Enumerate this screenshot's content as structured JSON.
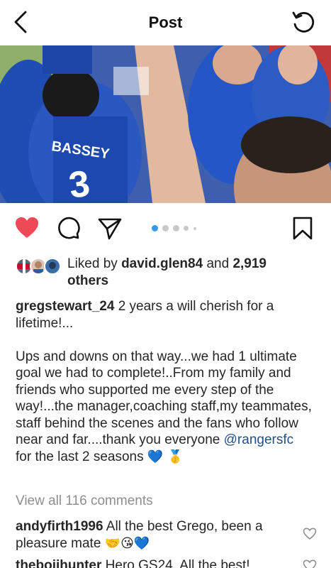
{
  "header": {
    "title": "Post"
  },
  "actions": {
    "liked": true,
    "carousel_count": 5,
    "carousel_active": 1
  },
  "likes": {
    "prefix": "Liked by",
    "user": "david.glen84",
    "connector": "and",
    "count": "2,919",
    "suffix": "others"
  },
  "caption": {
    "username": "gregstewart_24",
    "line1": "2 years a will cherish for a lifetime!...",
    "para2": "Ups and downs on that way...we had 1 ultimate goal we had to complete!..From my family and friends who supported me every step of the way!...the manager,coaching staff,my teammates, staff behind the scenes and the fans who follow near and far....thank you everyone",
    "mention": "@rangersfc",
    "last_line": "for the last 2 seasons",
    "emojis": "💙 🥇"
  },
  "view_all_comments": "View all 116 comments",
  "comments": [
    {
      "username": "andyfirth1996",
      "text": "All the best Grego, been a pleasure mate",
      "emojis": "🤝😘💙"
    },
    {
      "username": "thebojihunter",
      "text": "Hero GS24. All the best!"
    }
  ],
  "colors": {
    "like_red": "#ed4956",
    "mention": "#1f4f86",
    "muted": "#8e8e8e",
    "kit_blue": "#1c4aa8"
  },
  "icons": [
    "back-chevron-icon",
    "refresh-icon",
    "heart-icon",
    "comment-bubble-icon",
    "send-icon",
    "bookmark-icon"
  ]
}
